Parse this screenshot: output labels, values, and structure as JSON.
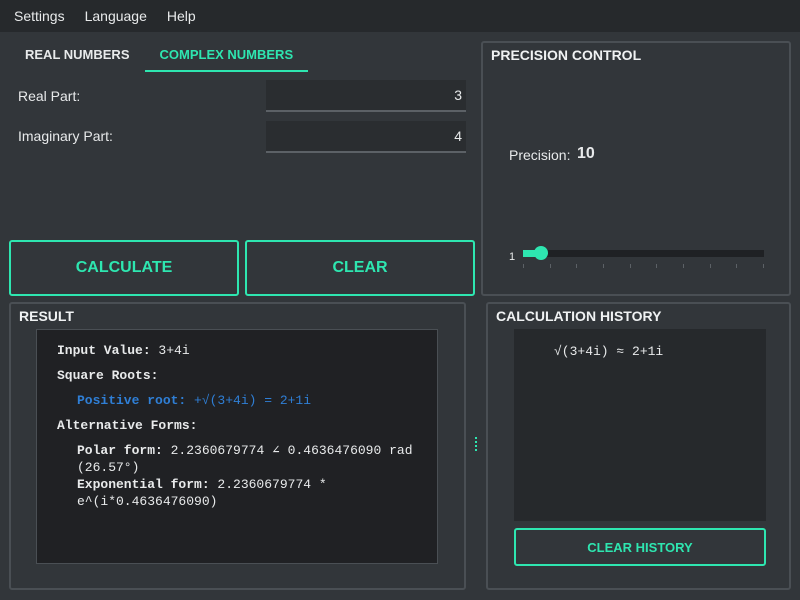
{
  "menu": {
    "items": [
      "Settings",
      "Language",
      "Help"
    ]
  },
  "tabs": [
    {
      "label": "REAL NUMBERS",
      "active": false
    },
    {
      "label": "COMPLEX NUMBERS",
      "active": true
    }
  ],
  "inputs": {
    "real_label": "Real Part:",
    "real_value": "3",
    "imag_label": "Imaginary Part:",
    "imag_value": "4"
  },
  "buttons": {
    "calculate": "CALCULATE",
    "clear": "CLEAR"
  },
  "precision": {
    "title": "PRECISION CONTROL",
    "label": "Precision:",
    "value": "10",
    "min_label": "1",
    "slider_level": 0.02
  },
  "result": {
    "title": "RESULT",
    "input_label": "Input Value:",
    "input_value": " 3+4i",
    "square_roots_heading": "Square Roots:",
    "positive_root_label": "Positive root:",
    "positive_root_value": " +√(3+4i) = 2+1i",
    "alt_forms_heading": "Alternative Forms:",
    "polar_label": "Polar form:",
    "polar_value": " 2.2360679774 ∠ 0.4636476090 rad",
    "polar_value_2": "(26.57°)",
    "exp_label": "Exponential form:",
    "exp_value": " 2.2360679774 *",
    "exp_value_2": "e^(i*0.4636476090)"
  },
  "history": {
    "title": "CALCULATION HISTORY",
    "entries": [
      "√(3+4i) ≈ 2+1i"
    ],
    "clear_label": "CLEAR HISTORY"
  },
  "colors": {
    "accent": "#2ee6b0",
    "background": "#32363a",
    "menubar": "#26292c",
    "link_blue": "#2f7fd6"
  }
}
